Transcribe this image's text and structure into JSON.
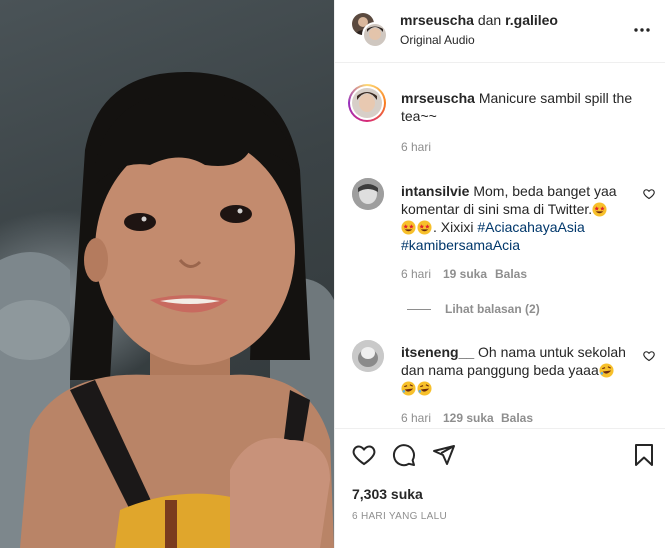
{
  "header": {
    "username": "mrseuscha",
    "connector": "dan",
    "collaborator": "r.galileo",
    "audio": "Original Audio",
    "more_icon": "more-horizontal-icon"
  },
  "caption": {
    "username": "mrseuscha",
    "text": "Manicure sambil spill the tea~~",
    "time": "6 hari"
  },
  "comments": [
    {
      "username": "intansilvie",
      "text": "Mom, beda banget yaa komentar di sini sma di Twitter.",
      "text2": ". Xixixi",
      "hashtag1": "#AciacahayaAsia",
      "hashtag2": "#kamibersamaAcia",
      "time": "6 hari",
      "likes": "19 suka",
      "reply": "Balas",
      "view_replies": "Lihat balasan (2)"
    },
    {
      "username": "itseneng__",
      "text": "Oh nama untuk sekolah dan nama panggung beda yaaa",
      "time": "6 hari",
      "likes": "129 suka",
      "reply": "Balas"
    }
  ],
  "actions": {
    "icons": [
      "heart-icon",
      "comment-icon",
      "share-icon",
      "bookmark-icon"
    ]
  },
  "likes": "7,303 suka",
  "posted": "6 HARI YANG LALU"
}
